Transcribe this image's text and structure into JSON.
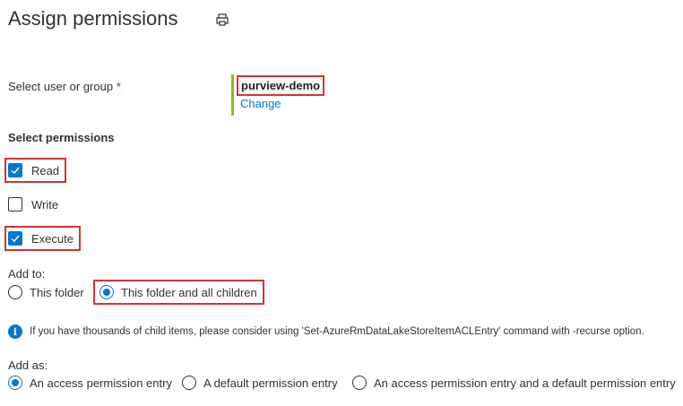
{
  "page": {
    "title": "Assign permissions",
    "print_icon": "print-icon"
  },
  "user": {
    "label": "Select user or group",
    "required_mark": "*",
    "selected_name": "purview-demo",
    "change_label": "Change"
  },
  "permissions": {
    "title": "Select permissions",
    "items": [
      {
        "label": "Read",
        "checked": true
      },
      {
        "label": "Write",
        "checked": false
      },
      {
        "label": "Execute",
        "checked": true
      }
    ]
  },
  "add_to": {
    "label": "Add to:",
    "options": [
      {
        "label": "This folder",
        "selected": false
      },
      {
        "label": "This folder and all children",
        "selected": true
      }
    ]
  },
  "info": {
    "icon": "info-icon",
    "glyph": "i",
    "text": "If you have thousands of child items, please consider using 'Set-AzureRmDataLakeStoreItemACLEntry' command with -recurse option."
  },
  "add_as": {
    "label": "Add as:",
    "options": [
      {
        "label": "An access permission entry",
        "selected": true
      },
      {
        "label": "A default permission entry",
        "selected": false
      },
      {
        "label": "An access permission entry and a default permission entry",
        "selected": false
      }
    ]
  },
  "colors": {
    "accent": "#0078d4",
    "highlight": "#d13438",
    "user_bar": "#8cbd18"
  }
}
